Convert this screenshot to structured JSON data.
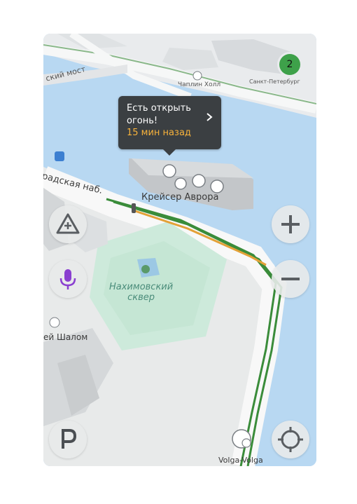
{
  "map": {
    "labels": {
      "bridge": "ский мост",
      "hall": "Чаплин Холл",
      "spb_label": "Санкт-Петербург",
      "embankment": "радская наб.",
      "aurora": "Крейсер Аврора",
      "square": "Нахимовский\nсквер",
      "shalom": "ей Шалом",
      "volga": "Volga-Volga"
    }
  },
  "popup": {
    "text": "Есть открыть огонь!",
    "time": "15 мин назад"
  },
  "badge": {
    "count": "2",
    "color": "#3ea14a"
  },
  "controls": {
    "warning_icon": "warning-add-icon",
    "voice_icon": "microphone-icon",
    "parking_icon": "parking-icon",
    "zoom_in_icon": "plus-icon",
    "zoom_out_icon": "minus-icon",
    "locate_icon": "crosshair-icon"
  },
  "colors": {
    "water": "#b8d8f2",
    "route_green": "#3a8c3a",
    "route_orange": "#e3a137",
    "park": "#cdeadb",
    "mic_purple": "#8a3fd0"
  }
}
